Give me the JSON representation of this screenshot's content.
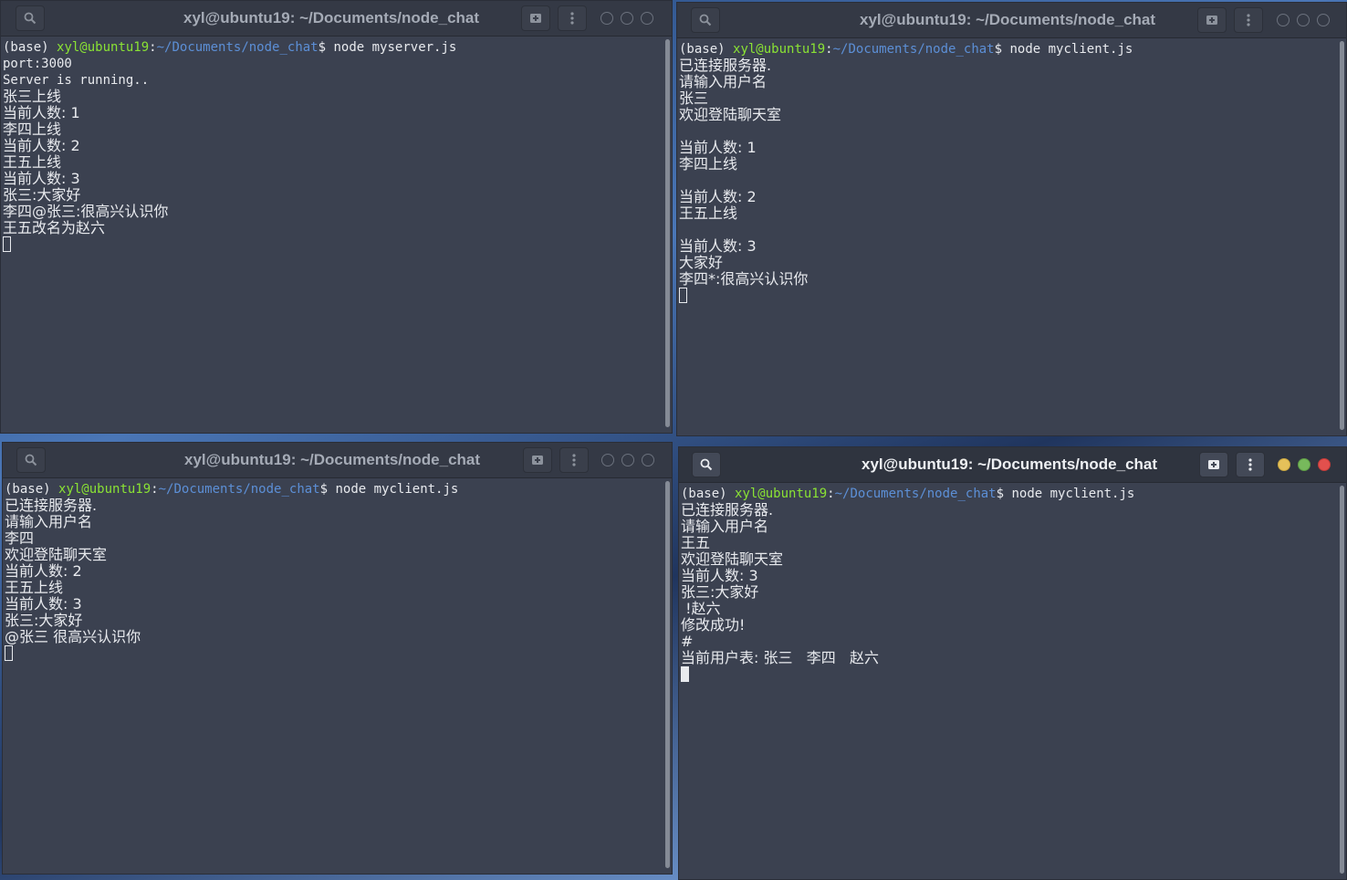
{
  "windows": [
    {
      "title": "xyl@ubuntu19: ~/Documents/node_chat",
      "prompt": {
        "env": "(base) ",
        "user_host": "xyl@ubuntu19",
        "sep": ":",
        "path": "~/Documents/node_chat",
        "dollar": "$ ",
        "command": "node myserver.js"
      },
      "lines": [
        "port:3000",
        "Server is running..",
        "张三上线",
        "当前人数: 1",
        "李四上线",
        "当前人数: 2",
        "王五上线",
        "当前人数: 3",
        "张三:大家好",
        "李四@张三:很高兴认识你",
        "王五改名为赵六"
      ]
    },
    {
      "title": "xyl@ubuntu19: ~/Documents/node_chat",
      "prompt": {
        "env": "(base) ",
        "user_host": "xyl@ubuntu19",
        "sep": ":",
        "path": "~/Documents/node_chat",
        "dollar": "$ ",
        "command": "node myclient.js"
      },
      "lines": [
        "已连接服务器.",
        "请输入用户名",
        "张三",
        "欢迎登陆聊天室",
        "",
        "当前人数: 1",
        "李四上线",
        "",
        "当前人数: 2",
        "王五上线",
        "",
        "当前人数: 3",
        "大家好",
        "李四*:很高兴认识你"
      ]
    },
    {
      "title": "xyl@ubuntu19: ~/Documents/node_chat",
      "prompt": {
        "env": "(base) ",
        "user_host": "xyl@ubuntu19",
        "sep": ":",
        "path": "~/Documents/node_chat",
        "dollar": "$ ",
        "command": "node myclient.js"
      },
      "lines": [
        "已连接服务器.",
        "请输入用户名",
        "李四",
        "欢迎登陆聊天室",
        "当前人数: 2",
        "王五上线",
        "当前人数: 3",
        "张三:大家好",
        "@张三 很高兴认识你"
      ]
    },
    {
      "title": "xyl@ubuntu19: ~/Documents/node_chat",
      "prompt": {
        "env": "(base) ",
        "user_host": "xyl@ubuntu19",
        "sep": ":",
        "path": "~/Documents/node_chat",
        "dollar": "$ ",
        "command": "node myclient.js"
      },
      "lines": [
        "已连接服务器.",
        "请输入用户名",
        "王五",
        "欢迎登陆聊天室",
        "当前人数: 3",
        "张三:大家好",
        " !赵六",
        "修改成功!",
        "#",
        "当前用户表: 张三   李四   赵六"
      ]
    }
  ],
  "icons": {
    "search": "search-icon",
    "new_tab": "new-tab-icon",
    "menu": "menu-icon"
  },
  "colors": {
    "terminal_bg": "#3b4150",
    "user_host": "#8ae234",
    "path": "#5c8fd6",
    "close": "#e2504d",
    "minimize": "#e5c15a",
    "maximize": "#77b95c"
  }
}
